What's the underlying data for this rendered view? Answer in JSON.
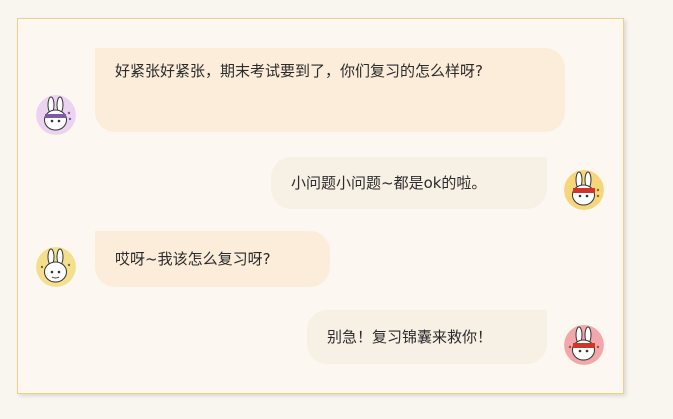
{
  "messages": [
    {
      "side": "left",
      "text": "好紧张好紧张，期末考试要到了，你们复习的怎么样呀?",
      "avatar": "rabbit-purple-avatar",
      "bg": "#ecd3f0",
      "accent": "#7e5aa6"
    },
    {
      "side": "right",
      "text": "小问题小问题~都是ok的啦。",
      "avatar": "rabbit-yellow-avatar",
      "bg": "#f7d57a",
      "accent": "#d0352c"
    },
    {
      "side": "left",
      "text": "哎呀~我该怎么复习呀?",
      "avatar": "rabbit-yellow-avatar",
      "bg": "#f3df8e",
      "accent": "#7d6a2e"
    },
    {
      "side": "right",
      "text": "别急！复习锦囊来救你！",
      "avatar": "rabbit-pink-avatar",
      "bg": "#f2a7ab",
      "accent": "#d0352c"
    }
  ],
  "colors": {
    "page_bg": "#f9f6ef",
    "panel_border": "#f0cf8c",
    "left_bubble": "#fbedd9",
    "right_bubble": "#f7f0e4"
  }
}
